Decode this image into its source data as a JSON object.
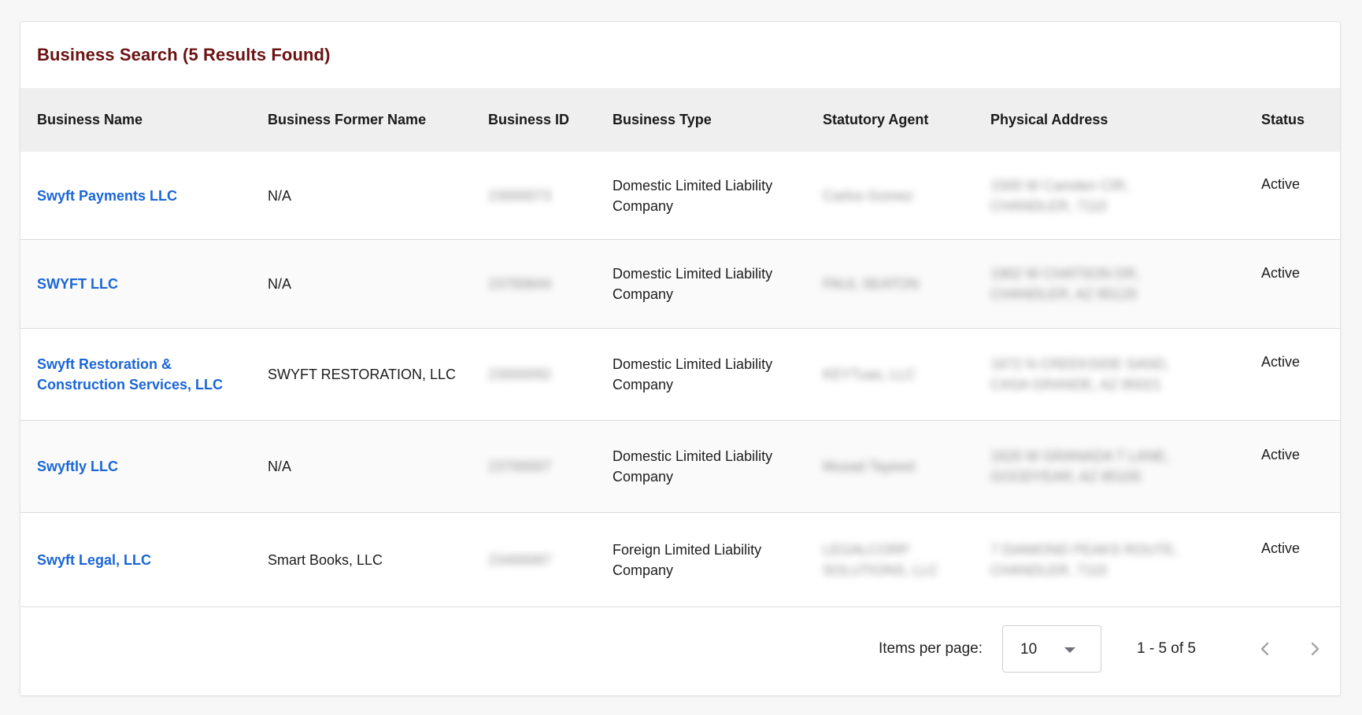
{
  "header": {
    "title": "Business Search (5 Results Found)"
  },
  "table": {
    "columns": [
      "Business Name",
      "Business Former Name",
      "Business ID",
      "Business Type",
      "Statutory Agent",
      "Physical Address",
      "Status"
    ],
    "rows": [
      {
        "name": "Swyft Payments LLC",
        "former_name": "N/A",
        "business_id": "23000073",
        "type": "Domestic Limited Liability Company",
        "agent": "Carlos Gomez",
        "address": "1500 W Camden CIR, CHANDLER, 7110",
        "status": "Active"
      },
      {
        "name": "SWYFT LLC",
        "former_name": "N/A",
        "business_id": "23700844",
        "type": "Domestic Limited Liability Company",
        "agent": "PAUL SEATON",
        "address": "1902 W CHATSON DR, CHANDLER, AZ 85120",
        "status": "Active"
      },
      {
        "name": "Swyft Restoration & Construction Services, LLC",
        "former_name": "SWYFT RESTORATION, LLC",
        "business_id": "23000092",
        "type": "Domestic Limited Liability Company",
        "agent": "KEYTuas, LLC",
        "address": "1672 N CREEKSIDE SAND, CASA GRANDE, AZ 85021",
        "status": "Active"
      },
      {
        "name": "Swyftly LLC",
        "former_name": "N/A",
        "business_id": "23700007",
        "type": "Domestic Limited Liability Company",
        "agent": "Musad Tayeed",
        "address": "1620 W GRANADA T LANE, GOODYEAR, AZ 85100",
        "status": "Active"
      },
      {
        "name": "Swyft Legal, LLC",
        "former_name": "Smart Books, LLC",
        "business_id": "23400087",
        "type": "Foreign Limited Liability Company",
        "agent": "LEGALCORP SOLUTIONS, LLC",
        "address": "7 DIAMOND PEAKS ROUTE, CHANDLER, 7110",
        "status": "Active"
      }
    ]
  },
  "pagination": {
    "items_per_page_label": "Items per page:",
    "items_per_page_value": "10",
    "range_label": "1 - 5 of 5"
  },
  "colors": {
    "title": "#6b1212",
    "link": "#1a66d6",
    "header_bg": "#efefef"
  },
  "icons": {
    "dropdown": "chevron-down-icon",
    "prev": "chevron-left-icon",
    "next": "chevron-right-icon"
  }
}
